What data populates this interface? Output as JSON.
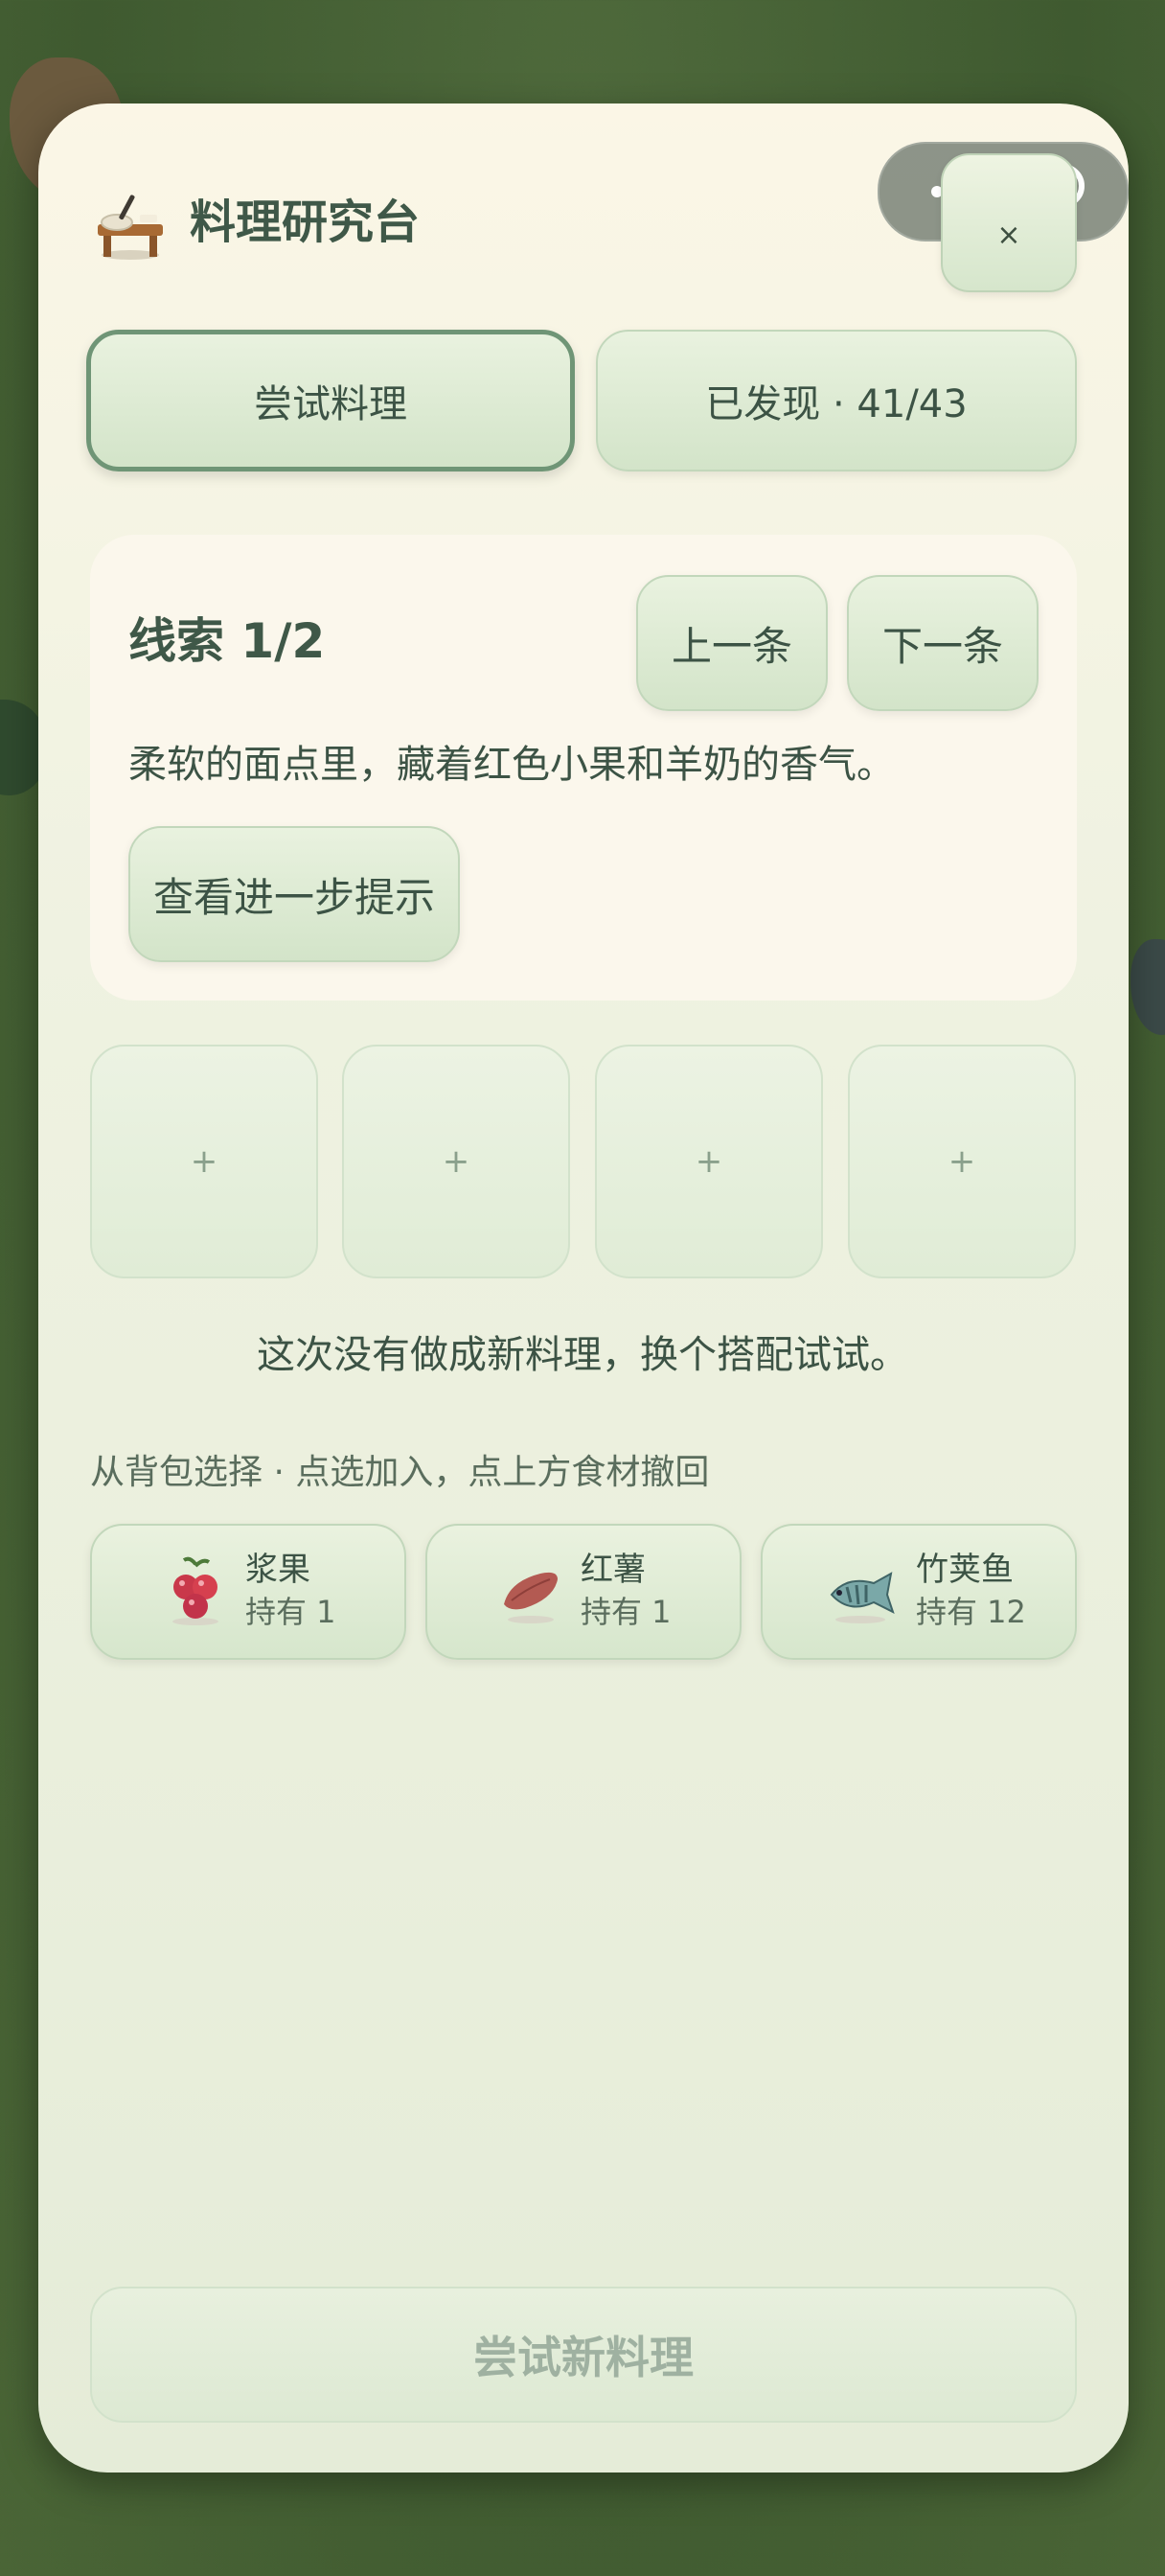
{
  "capsule": {
    "more_icon": "more-dots-icon",
    "close_icon": "target-circle-icon"
  },
  "header": {
    "title": "料理研究台",
    "icon": "cooking-table-icon",
    "close_label": "×"
  },
  "tabs": [
    {
      "label": "尝试料理",
      "active": true
    },
    {
      "label": "已发现 · 41/43",
      "active": false
    }
  ],
  "clue": {
    "title": "线索 1/2",
    "prev_label": "上一条",
    "next_label": "下一条",
    "text": "柔软的面点里，藏着红色小果和羊奶的香气。",
    "hint_label": "查看进一步提示"
  },
  "slots": [
    "+",
    "+",
    "+",
    "+"
  ],
  "result_message": "这次没有做成新料理，换个搭配试试。",
  "pick_label": "从背包选择 · 点选加入，点上方食材撤回",
  "inventory": [
    {
      "name": "浆果",
      "count": "持有 1",
      "icon": "berry-icon"
    },
    {
      "name": "红薯",
      "count": "持有 1",
      "icon": "sweet-potato-icon"
    },
    {
      "name": "竹荚鱼",
      "count": "持有 12",
      "icon": "fish-icon"
    }
  ],
  "submit_label": "尝试新料理",
  "colors": {
    "accent": "#6f9576",
    "text": "#3c5345",
    "button_bg": "#d6e6cc"
  }
}
